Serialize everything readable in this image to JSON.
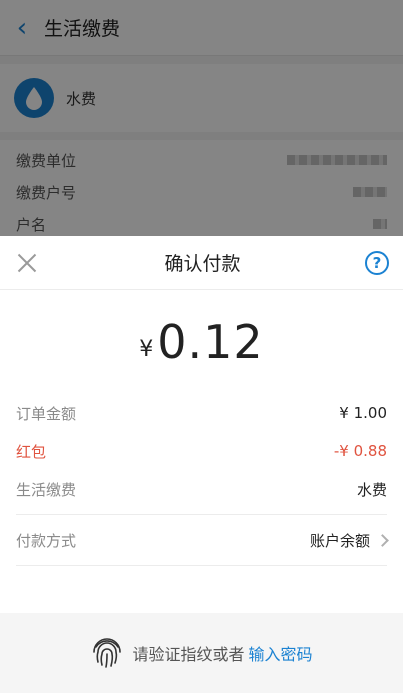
{
  "background": {
    "header": {
      "title": "生活缴费"
    },
    "biz_name": "水费",
    "rows": [
      {
        "label": "缴费单位"
      },
      {
        "label": "缴费户号"
      },
      {
        "label": "户名"
      }
    ]
  },
  "sheet": {
    "title": "确认付款",
    "amount": {
      "currency": "¥",
      "value": "0.12"
    },
    "details": [
      {
        "label": "订单金额",
        "value": "¥ 1.00",
        "highlight": false
      },
      {
        "label": "红包",
        "value": "-¥ 0.88",
        "highlight": true
      },
      {
        "label": "生活缴费",
        "value": "水费",
        "highlight": false
      }
    ],
    "payment_method": {
      "label": "付款方式",
      "value": "账户余额"
    },
    "footer": {
      "text": "请验证指纹或者",
      "link": "输入密码"
    }
  },
  "colors": {
    "accent": "#1b82d2",
    "red": "#e0533f"
  }
}
